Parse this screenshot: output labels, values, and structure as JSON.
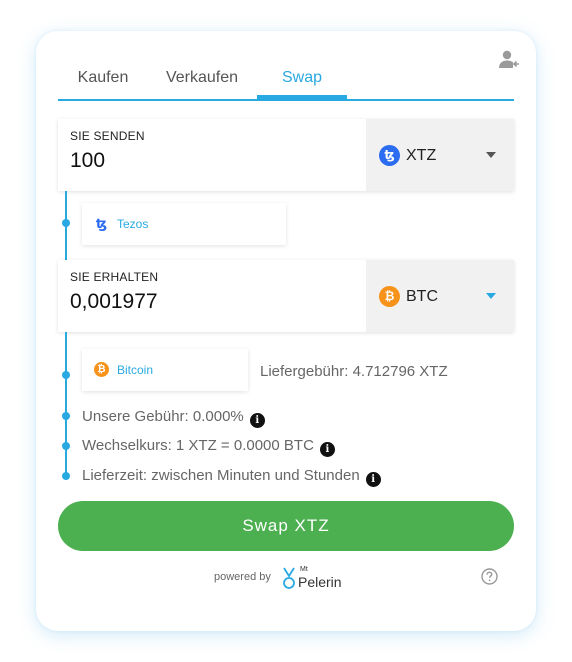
{
  "tabs": [
    {
      "label": "Kaufen"
    },
    {
      "label": "Verkaufen"
    },
    {
      "label": "Swap"
    }
  ],
  "send": {
    "label": "SIE SENDEN",
    "value": "100",
    "currency": "XTZ",
    "currency_icon": "tezos-icon",
    "network": "Tezos"
  },
  "receive": {
    "label": "SIE ERHALTEN",
    "value": "0,001977",
    "currency": "BTC",
    "currency_icon": "bitcoin-icon",
    "network": "Bitcoin"
  },
  "info": {
    "delivery_fee": "Liefergebühr: 4.712796 XTZ",
    "our_fee": "Unsere Gebühr: 0.000%",
    "exchange_rate": "Wechselkurs: 1 XTZ = 0.0000 BTC",
    "delivery_time": "Lieferzeit: zwischen Minuten und Stunden"
  },
  "swap_button": "Swap XTZ",
  "footer": {
    "powered_by": "powered by",
    "brand_prefix": "Mt",
    "brand_name": "Pelerin"
  },
  "colors": {
    "accent": "#29a9e1",
    "button": "#4caf50",
    "xtz": "#2b6cf0",
    "btc": "#f7931a"
  }
}
